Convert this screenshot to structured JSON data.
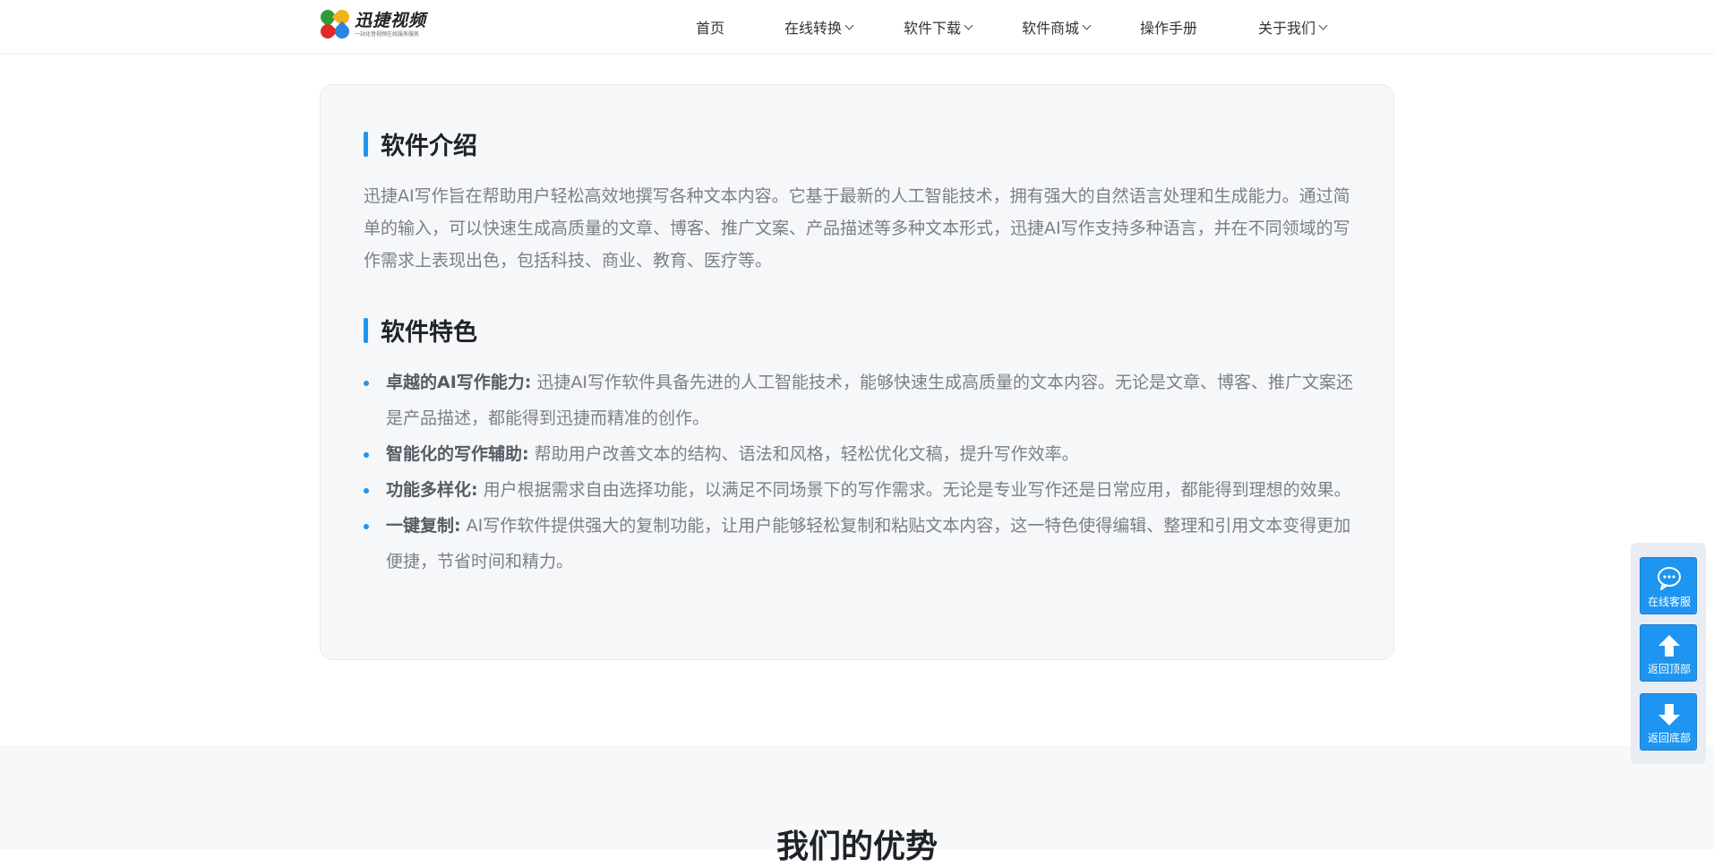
{
  "header": {
    "logo_name": "迅捷视频",
    "logo_slogan": "一站化音视频在线服务服务",
    "nav": [
      {
        "label": "首页",
        "has_dropdown": false
      },
      {
        "label": "在线转换",
        "has_dropdown": true
      },
      {
        "label": "软件下载",
        "has_dropdown": true
      },
      {
        "label": "软件商城",
        "has_dropdown": true
      },
      {
        "label": "操作手册",
        "has_dropdown": false
      },
      {
        "label": "关于我们",
        "has_dropdown": true
      }
    ]
  },
  "intro": {
    "title": "软件介绍",
    "text": "迅捷AI写作旨在帮助用户轻松高效地撰写各种文本内容。它基于最新的人工智能技术，拥有强大的自然语言处理和生成能力。通过简单的输入，可以快速生成高质量的文章、博客、推广文案、产品描述等多种文本形式，迅捷AI写作支持多种语言，并在不同领域的写作需求上表现出色，包括科技、商业、教育、医疗等。"
  },
  "features": {
    "title": "软件特色",
    "items": [
      {
        "heading": "卓越的AI写作能力:",
        "text": " 迅捷AI写作软件具备先进的人工智能技术，能够快速生成高质量的文本内容。无论是文章、博客、推广文案还是产品描述，都能得到迅捷而精准的创作。"
      },
      {
        "heading": "智能化的写作辅助:",
        "text": " 帮助用户改善文本的结构、语法和风格，轻松优化文稿，提升写作效率。"
      },
      {
        "heading": "功能多样化:",
        "text": " 用户根据需求自由选择功能，以满足不同场景下的写作需求。无论是专业写作还是日常应用，都能得到理想的效果。"
      },
      {
        "heading": "一键复制:",
        "text": " AI写作软件提供强大的复制功能，让用户能够轻松复制和粘贴文本内容，这一特色使得编辑、整理和引用文本变得更加便捷，节省时间和精力。"
      }
    ]
  },
  "advantages": {
    "title": "我们的优势"
  },
  "float_panel": {
    "service": "在线客服",
    "top": "返回顶部",
    "bottom": "返回底部"
  },
  "colors": {
    "accent": "#1e95f0",
    "card_bg": "#f6f7f9",
    "text_muted": "#7a7f88"
  }
}
